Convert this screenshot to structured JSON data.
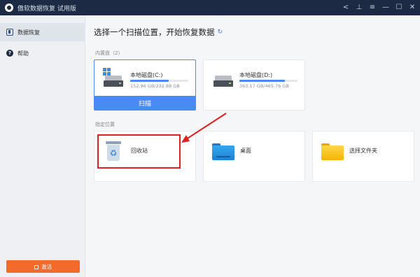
{
  "window": {
    "title": "傲软数据恢复 试用版",
    "controls": [
      "share-icon",
      "save-icon",
      "menu-icon",
      "minimize-icon",
      "maximize-icon",
      "close-icon"
    ]
  },
  "sidebar": {
    "items": [
      {
        "label": "数据恢复",
        "icon": "data-recovery-icon",
        "active": true
      },
      {
        "label": "帮助",
        "icon": "help-icon",
        "active": false
      }
    ],
    "activate_label": "激活"
  },
  "main": {
    "title": "选择一个扫描位置，开始恢复数据",
    "refresh_icon": "refresh-icon"
  },
  "drives": {
    "section_label": "内置盘（2）",
    "items": [
      {
        "name": "本地磁盘(C:)",
        "size": "152.96 GB/232.88 GB",
        "used_fraction": 0.657,
        "selected": true,
        "scan_label": "扫描"
      },
      {
        "name": "本地磁盘(D:)",
        "size": "363.17 GB/465.76 GB",
        "used_fraction": 0.78,
        "selected": false
      }
    ]
  },
  "locations": {
    "section_label": "指定位置",
    "items": [
      {
        "name": "回收站",
        "icon": "recycle-bin-icon",
        "highlighted": true
      },
      {
        "name": "桌面",
        "icon": "desktop-folder-icon"
      },
      {
        "name": "选择文件夹",
        "icon": "folder-icon"
      }
    ]
  },
  "colors": {
    "titlebar": "#1d2a43",
    "accent": "#4a8af4",
    "activate": "#f26b2a",
    "annotation": "#e02020"
  }
}
